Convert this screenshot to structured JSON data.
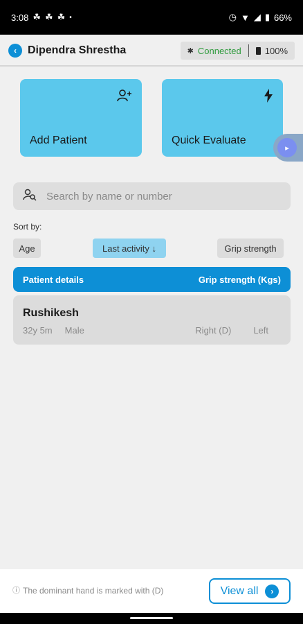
{
  "status_bar": {
    "time": "3:08",
    "notification_icons": [
      "ghost-icon",
      "ghost-icon",
      "ghost-icon"
    ],
    "dot": "•",
    "battery": "66%",
    "icons": [
      "alarm-icon",
      "wifi-icon",
      "signal-icon",
      "battery-icon"
    ]
  },
  "header": {
    "name": "Dipendra Shrestha",
    "connection": "Connected",
    "device_battery": "100%"
  },
  "actions": {
    "add_patient": "Add Patient",
    "quick_evaluate": "Quick Evaluate"
  },
  "search": {
    "placeholder": "Search by name or number"
  },
  "sort": {
    "label": "Sort by:",
    "options": [
      "Age",
      "Last activity ↓",
      "Grip strength"
    ],
    "selected": "Last activity ↓"
  },
  "table": {
    "col_patient": "Patient details",
    "col_grip": "Grip strength (Kgs)"
  },
  "patients": [
    {
      "name": "Rushikesh",
      "age": "32y 5m",
      "gender": "Male",
      "right": "Right (D)",
      "left": "Left"
    }
  ],
  "footer": {
    "note": "The dominant hand is marked with (D)",
    "view_all": "View all"
  },
  "colors": {
    "accent": "#0d8fd6",
    "card": "#5bc8ec",
    "connected": "#2e9a3c"
  }
}
